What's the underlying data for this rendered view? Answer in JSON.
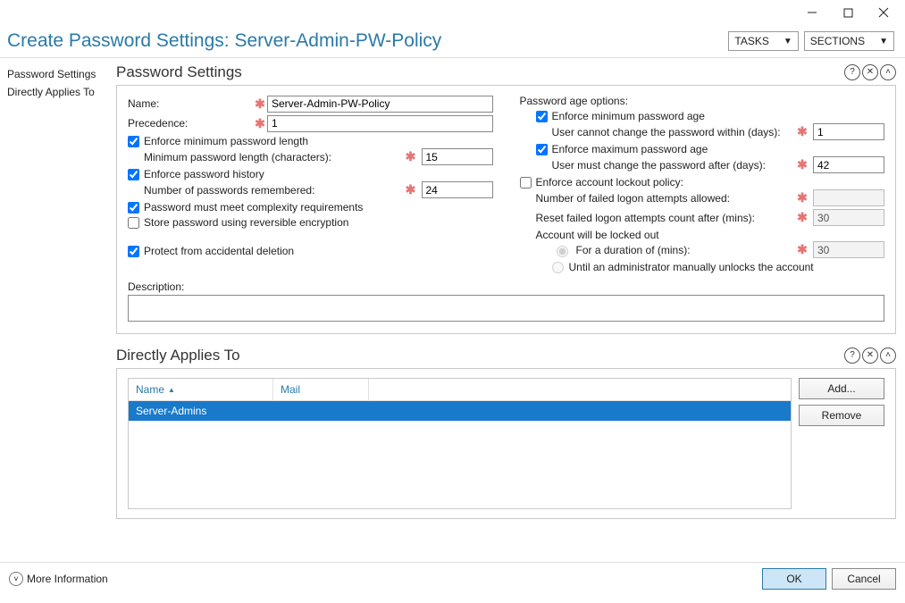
{
  "window": {
    "title": "Create Password Settings: Server-Admin-PW-Policy"
  },
  "header": {
    "tasks_label": "TASKS",
    "sections_label": "SECTIONS"
  },
  "nav": {
    "password_settings": "Password Settings",
    "directly_applies": "Directly Applies To"
  },
  "section1": {
    "title": "Password Settings",
    "name_label": "Name:",
    "name_value": "Server-Admin-PW-Policy",
    "precedence_label": "Precedence:",
    "precedence_value": "1",
    "min_len_chk": "Enforce minimum password length",
    "min_len_label": "Minimum password length (characters):",
    "min_len_value": "15",
    "history_chk": "Enforce password history",
    "history_label": "Number of passwords remembered:",
    "history_value": "24",
    "complexity_chk": "Password must meet complexity requirements",
    "reversible_chk": "Store password using reversible encryption",
    "protect_chk": "Protect from accidental deletion",
    "desc_label": "Description:",
    "desc_value": "",
    "age_header": "Password age options:",
    "min_age_chk": "Enforce minimum password age",
    "min_age_label": "User cannot change the password within (days):",
    "min_age_value": "1",
    "max_age_chk": "Enforce maximum password age",
    "max_age_label": "User must change the password after (days):",
    "max_age_value": "42",
    "lockout_chk": "Enforce account lockout policy:",
    "lockout_attempts_label": "Number of failed logon attempts allowed:",
    "lockout_attempts_value": "",
    "lockout_reset_label": "Reset failed logon attempts count after (mins):",
    "lockout_reset_value": "30",
    "locked_out_label": "Account will be locked out",
    "dur_radio": "For a duration of (mins):",
    "dur_value": "30",
    "until_radio": "Until an administrator manually unlocks the account"
  },
  "section2": {
    "title": "Directly Applies To",
    "col_name": "Name",
    "col_mail": "Mail",
    "row0_name": "Server-Admins",
    "add_btn": "Add...",
    "remove_btn": "Remove"
  },
  "footer": {
    "more_info": "More Information",
    "ok": "OK",
    "cancel": "Cancel"
  }
}
